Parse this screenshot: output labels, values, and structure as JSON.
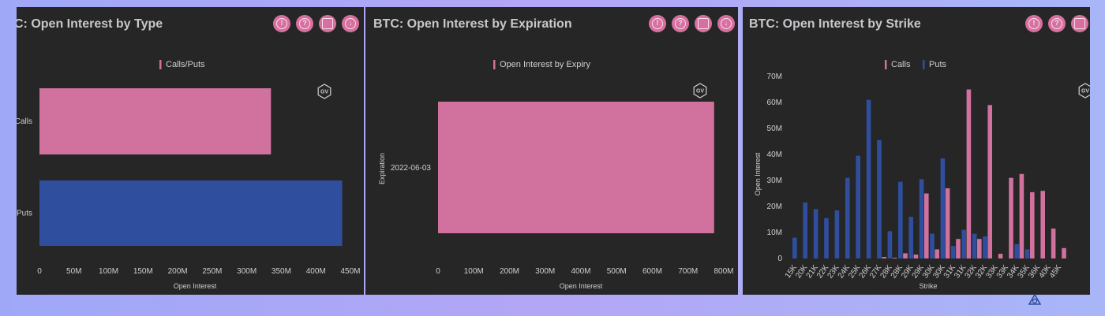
{
  "colors": {
    "calls": "#d0719e",
    "puts": "#2f4f9e",
    "panel": "#262626",
    "text": "#cfcfd3",
    "tool": "#d8709f"
  },
  "watermark": "GV",
  "toolbar_icons": [
    "info-icon",
    "help-icon",
    "camera-icon",
    "download-icon"
  ],
  "panels": [
    {
      "title": "C: Open Interest by Type"
    },
    {
      "title": "BTC: Open Interest by Expiration"
    },
    {
      "title": "BTC: Open Interest by Strike"
    }
  ],
  "chart_data": [
    {
      "type": "bar",
      "orientation": "horizontal",
      "title": "C: Open Interest by Type",
      "categories": [
        "Calls",
        "Puts"
      ],
      "series": [
        {
          "name": "Calls/Puts",
          "values": [
            335000000,
            438000000
          ],
          "colors": [
            "#d0719e",
            "#2f4f9e"
          ]
        }
      ],
      "xlabel": "Open Interest",
      "xlim": [
        0,
        450000000
      ],
      "xticks": [
        0,
        50000000,
        100000000,
        150000000,
        200000000,
        250000000,
        300000000,
        350000000,
        400000000,
        450000000
      ],
      "xtick_labels": [
        "0",
        "50M",
        "100M",
        "150M",
        "200M",
        "250M",
        "300M",
        "350M",
        "400M",
        "450M"
      ],
      "legend": "top-center",
      "grid": false
    },
    {
      "type": "bar",
      "orientation": "horizontal",
      "title": "BTC: Open Interest by Expiration",
      "categories": [
        "2022-06-03"
      ],
      "series": [
        {
          "name": "Open Interest by Expiry",
          "values": [
            773000000
          ]
        }
      ],
      "xlabel": "Open Interest",
      "ylabel": "Expiration",
      "xlim": [
        0,
        800000000
      ],
      "xticks": [
        0,
        100000000,
        200000000,
        300000000,
        400000000,
        500000000,
        600000000,
        700000000,
        800000000
      ],
      "xtick_labels": [
        "0",
        "100M",
        "200M",
        "300M",
        "400M",
        "500M",
        "600M",
        "700M",
        "800M"
      ],
      "legend": "top-center",
      "grid": false
    },
    {
      "type": "bar",
      "orientation": "vertical",
      "title": "BTC: Open Interest by Strike",
      "categories": [
        "15K",
        "20K",
        "21K",
        "22K",
        "23K",
        "24K",
        "25K",
        "26K",
        "27K",
        "28K",
        "28K",
        "29K",
        "29K",
        "30K",
        "30K",
        "31K",
        "31K",
        "32K",
        "32K",
        "33K",
        "33K",
        "34K",
        "35K",
        "36K",
        "40K",
        "45K"
      ],
      "series": [
        {
          "name": "Calls",
          "values": [
            0,
            0,
            0,
            0,
            0,
            0,
            0,
            0,
            600000,
            300000,
            2000000,
            1500000,
            25000000,
            3500000,
            27000000,
            7500000,
            65000000,
            7500000,
            59000000,
            1800000,
            31000000,
            32500000,
            25500000,
            26000000,
            11500000,
            4000000
          ]
        },
        {
          "name": "Puts",
          "values": [
            8000000,
            21500000,
            19000000,
            15500000,
            18500000,
            31000000,
            39500000,
            61000000,
            45500000,
            10500000,
            29500000,
            16000000,
            30500000,
            9500000,
            38500000,
            4800000,
            11000000,
            9500000,
            8500000,
            0,
            0,
            5500000,
            3500000,
            0,
            0,
            0
          ]
        }
      ],
      "xlabel": "Strike",
      "ylabel": "Open Interest",
      "ylim": [
        0,
        70000000
      ],
      "yticks": [
        0,
        10000000,
        20000000,
        30000000,
        40000000,
        50000000,
        60000000,
        70000000
      ],
      "ytick_labels": [
        "0",
        "10M",
        "20M",
        "30M",
        "40M",
        "50M",
        "60M",
        "70M"
      ],
      "legend": "top-center",
      "grid": false
    }
  ]
}
